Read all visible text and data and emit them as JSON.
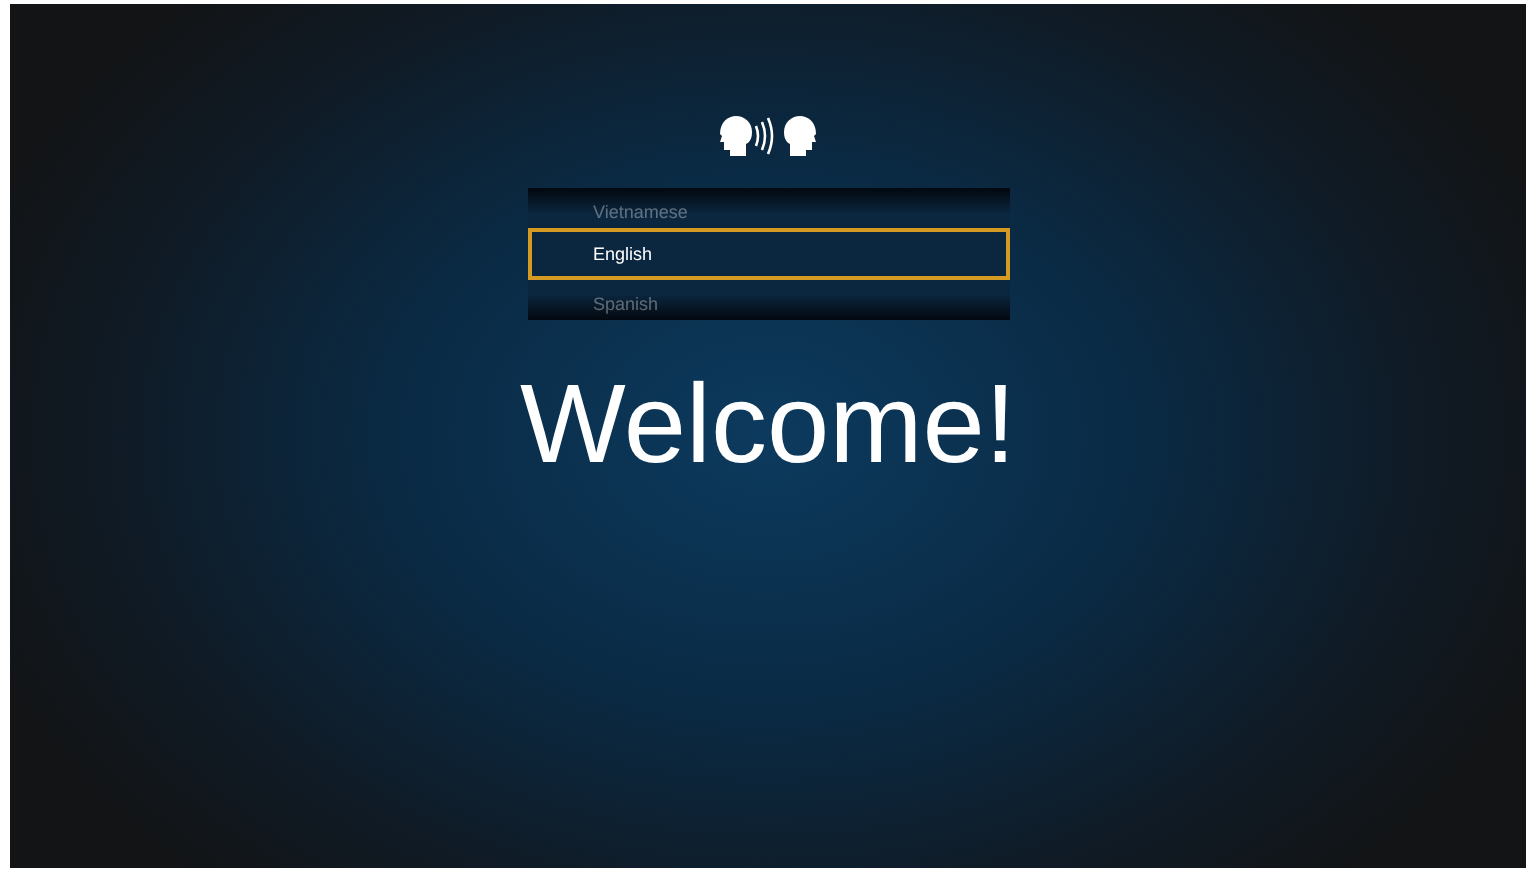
{
  "languages": [
    {
      "label": "Vietnamese",
      "selected": false
    },
    {
      "label": "English",
      "selected": true
    },
    {
      "label": "Spanish",
      "selected": false
    }
  ],
  "heading": "Welcome!"
}
